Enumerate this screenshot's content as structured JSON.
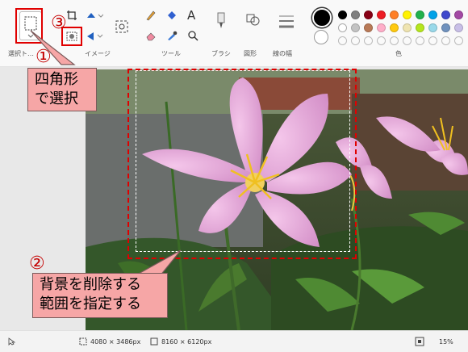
{
  "ribbon": {
    "select_label": "選択ト…",
    "image_label": "イメージ",
    "tools_label": "ツール",
    "brush_label": "ブラシ",
    "shapes_label": "図形",
    "line_width_label": "線の幅",
    "colors_label": "色"
  },
  "annotations": {
    "step1_number": "①",
    "step1_text_line1": "四角形",
    "step1_text_line2": "で選択",
    "step2_number": "②",
    "step2_text_line1": "背景を削除する",
    "step2_text_line2": "範囲を指定する",
    "step3_number": "③",
    "accent_color": "#e00000",
    "callout_color": "#f6a6a6"
  },
  "colors": {
    "primary": "#000000",
    "secondary": "#ffffff",
    "row1": [
      "#000000",
      "#7f7f7f",
      "#880015",
      "#ed1c24",
      "#ff7f27",
      "#fff200",
      "#22b14c",
      "#00a2e8",
      "#3f48cc",
      "#a349a4"
    ],
    "row2": [
      "#ffffff",
      "#c3c3c3",
      "#b97a57",
      "#ffaec9",
      "#ffc90e",
      "#efe4b0",
      "#b5e61d",
      "#99d9ea",
      "#7092be",
      "#c8bfe7"
    ]
  },
  "status": {
    "selection_size": "4080 × 3486px",
    "image_size": "8160 × 6120px",
    "zoom": "15%"
  }
}
